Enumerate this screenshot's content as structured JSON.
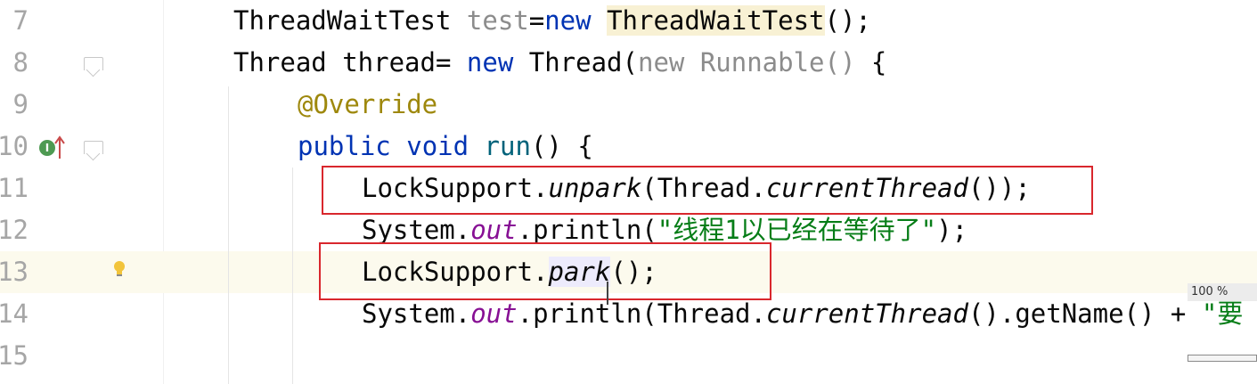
{
  "editor": {
    "lines": [
      {
        "number": "7",
        "tokens": [
          {
            "t": "ThreadWaitTest ",
            "c": "plain"
          },
          {
            "t": "test",
            "c": "gray"
          },
          {
            "t": "=",
            "c": "plain"
          },
          {
            "t": "new",
            "c": "kw"
          },
          {
            "t": " ",
            "c": "plain"
          },
          {
            "t": "ThreadWaitTest",
            "c": "hl-yellow"
          },
          {
            "t": "();",
            "c": "plain"
          }
        ]
      },
      {
        "number": "8",
        "tokens": [
          {
            "t": "Thread thread= ",
            "c": "plain"
          },
          {
            "t": "new",
            "c": "kw"
          },
          {
            "t": " Thread(",
            "c": "plain"
          },
          {
            "t": "new Runnable()",
            "c": "gray"
          },
          {
            "t": " {",
            "c": "plain"
          }
        ]
      },
      {
        "number": "9",
        "tokens": [
          {
            "t": "@Override",
            "c": "ann"
          }
        ]
      },
      {
        "number": "10",
        "tokens": [
          {
            "t": "public",
            "c": "kw"
          },
          {
            "t": " ",
            "c": "plain"
          },
          {
            "t": "void",
            "c": "kw"
          },
          {
            "t": " ",
            "c": "plain"
          },
          {
            "t": "run",
            "c": "method"
          },
          {
            "t": "() {",
            "c": "plain"
          }
        ]
      },
      {
        "number": "11",
        "tokens": [
          {
            "t": "LockSupport.",
            "c": "plain"
          },
          {
            "t": "unpark",
            "c": "stat"
          },
          {
            "t": "(Thread.",
            "c": "plain"
          },
          {
            "t": "currentThread",
            "c": "stat"
          },
          {
            "t": "());",
            "c": "plain"
          }
        ]
      },
      {
        "number": "12",
        "tokens": [
          {
            "t": "System.",
            "c": "plain"
          },
          {
            "t": "out",
            "c": "fld"
          },
          {
            "t": ".println(",
            "c": "plain"
          },
          {
            "t": "\"线程1以已经在等待了\"",
            "c": "str"
          },
          {
            "t": ");",
            "c": "plain"
          }
        ]
      },
      {
        "number": "13",
        "tokens": [
          {
            "t": "LockSupport.",
            "c": "plain"
          },
          {
            "t": "park",
            "c": "stat-ref"
          },
          {
            "t": "();",
            "c": "plain"
          }
        ]
      },
      {
        "number": "14",
        "tokens": [
          {
            "t": "System.",
            "c": "plain"
          },
          {
            "t": "out",
            "c": "fld"
          },
          {
            "t": ".println(Thread.",
            "c": "plain"
          },
          {
            "t": "currentThread",
            "c": "stat"
          },
          {
            "t": "().getName() + ",
            "c": "plain"
          },
          {
            "t": "\"要",
            "c": "str"
          }
        ]
      },
      {
        "number": "15",
        "tokens": []
      }
    ],
    "gutter_icons": {
      "implements_marker": "I",
      "implements_icon": "implements-method-icon",
      "arrow_icon": "override-arrow-icon",
      "bulb_icon": "intention-bulb-icon"
    },
    "zoom_badge": "100 %",
    "colors": {
      "keyword": "#0033b3",
      "annotation": "#9e880d",
      "string": "#067d17",
      "field": "#871094",
      "gray": "#8c8c8c",
      "annotation_box": "#d9272d",
      "current_line": "#fcfaed"
    }
  }
}
